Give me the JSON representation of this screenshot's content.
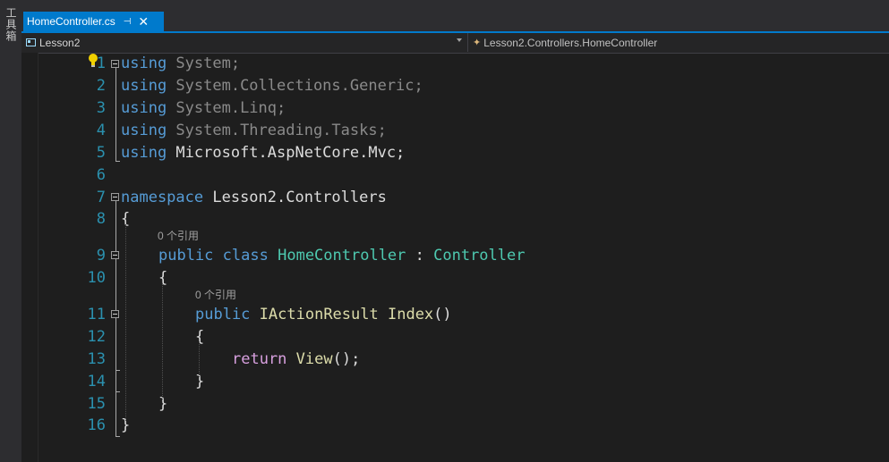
{
  "toolbox": {
    "label": "工具箱"
  },
  "tab": {
    "filename": "HomeController.cs",
    "pin_icon": "pin-icon",
    "close_icon": "close-icon"
  },
  "navbar": {
    "project": "Lesson2",
    "member": "Lesson2.Controllers.HomeController"
  },
  "editor": {
    "codelens": [
      "0 个引用",
      "0 个引用"
    ],
    "lines": [
      {
        "n": "1",
        "tokens": [
          {
            "t": "using",
            "c": "kw"
          },
          {
            "t": " System;",
            "c": "dim"
          }
        ]
      },
      {
        "n": "2",
        "tokens": [
          {
            "t": "using",
            "c": "kw"
          },
          {
            "t": " System.Collections.Generic;",
            "c": "dim"
          }
        ]
      },
      {
        "n": "3",
        "tokens": [
          {
            "t": "using",
            "c": "kw"
          },
          {
            "t": " System.Linq;",
            "c": "dim"
          }
        ]
      },
      {
        "n": "4",
        "tokens": [
          {
            "t": "using",
            "c": "kw"
          },
          {
            "t": " System.Threading.Tasks;",
            "c": "dim"
          }
        ]
      },
      {
        "n": "5",
        "tokens": [
          {
            "t": "using",
            "c": "kw"
          },
          {
            "t": " Microsoft.AspNetCore.Mvc;",
            "c": ""
          }
        ]
      },
      {
        "n": "6",
        "tokens": []
      },
      {
        "n": "7",
        "tokens": [
          {
            "t": "namespace",
            "c": "kw"
          },
          {
            "t": " Lesson2.Controllers",
            "c": ""
          }
        ]
      },
      {
        "n": "8",
        "tokens": [
          {
            "t": "{",
            "c": ""
          }
        ]
      },
      {
        "n": "9",
        "tokens": [
          {
            "t": "public",
            "c": "kw"
          },
          {
            "t": " ",
            "c": ""
          },
          {
            "t": "class",
            "c": "kw"
          },
          {
            "t": " ",
            "c": ""
          },
          {
            "t": "HomeController",
            "c": "ty"
          },
          {
            "t": " : ",
            "c": ""
          },
          {
            "t": "Controller",
            "c": "ty"
          }
        ]
      },
      {
        "n": "10",
        "tokens": [
          {
            "t": "{",
            "c": ""
          }
        ]
      },
      {
        "n": "11",
        "tokens": [
          {
            "t": "public",
            "c": "kw"
          },
          {
            "t": " ",
            "c": ""
          },
          {
            "t": "IActionResult",
            "c": "fn"
          },
          {
            "t": " ",
            "c": ""
          },
          {
            "t": "Index",
            "c": "fn"
          },
          {
            "t": "()",
            "c": ""
          }
        ]
      },
      {
        "n": "12",
        "tokens": [
          {
            "t": "{",
            "c": ""
          }
        ]
      },
      {
        "n": "13",
        "tokens": [
          {
            "t": "return",
            "c": "ctl"
          },
          {
            "t": " ",
            "c": ""
          },
          {
            "t": "View",
            "c": "fn"
          },
          {
            "t": "();",
            "c": ""
          }
        ]
      },
      {
        "n": "14",
        "tokens": [
          {
            "t": "}",
            "c": ""
          }
        ]
      },
      {
        "n": "15",
        "tokens": [
          {
            "t": "}",
            "c": ""
          }
        ]
      },
      {
        "n": "16",
        "tokens": [
          {
            "t": "}",
            "c": ""
          }
        ]
      }
    ]
  }
}
